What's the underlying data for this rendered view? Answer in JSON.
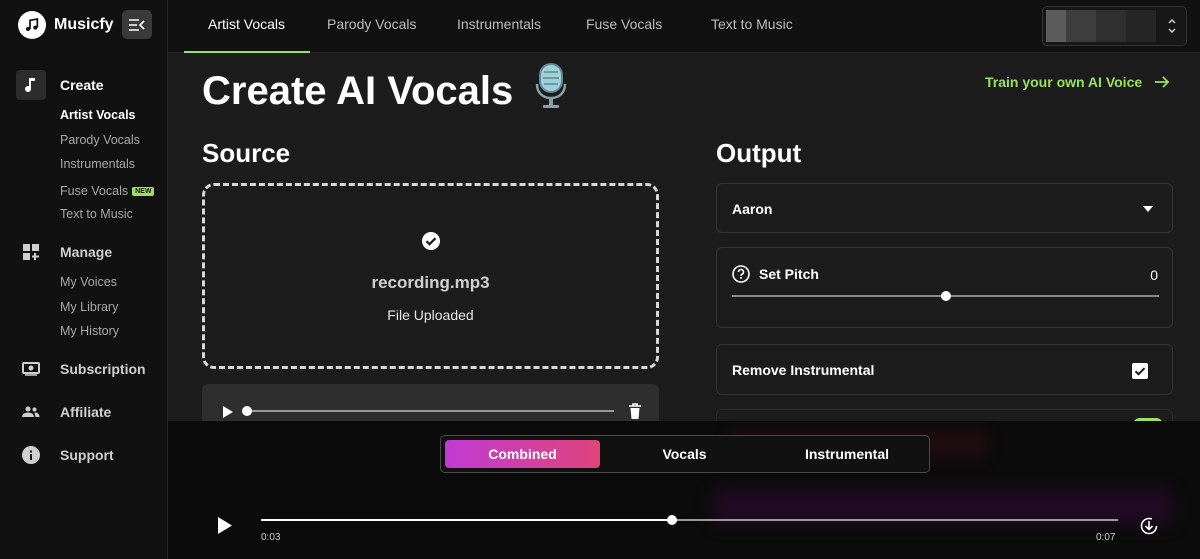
{
  "app": {
    "name": "Musicfy"
  },
  "sidebar": {
    "sections": [
      {
        "label": "Create",
        "icon": "music-note-icon"
      },
      {
        "label": "Manage",
        "icon": "grid-plus-icon"
      },
      {
        "label": "Subscription",
        "icon": "subscription-icon"
      },
      {
        "label": "Affiliate",
        "icon": "people-icon"
      },
      {
        "label": "Support",
        "icon": "info-icon"
      }
    ],
    "create_items": [
      "Artist Vocals",
      "Parody Vocals",
      "Instrumentals",
      "Fuse Vocals",
      "Text to Music"
    ],
    "new_badge": "NEW",
    "manage_items": [
      "My Voices",
      "My Library",
      "My History"
    ]
  },
  "tabs": [
    "Artist Vocals",
    "Parody Vocals",
    "Instrumentals",
    "Fuse Vocals",
    "Text to Music"
  ],
  "main": {
    "title": "Create AI Vocals",
    "train_link": "Train your own AI Voice",
    "source_heading": "Source",
    "output_heading": "Output",
    "file_name": "recording.mp3",
    "file_status": "File Uploaded",
    "voice_selected": "Aaron",
    "pitch_label": "Set Pitch",
    "pitch_value": "0",
    "pitch_fraction": 0.5,
    "remove_instrumental_label": "Remove Instrumental",
    "remove_instrumental_checked": true
  },
  "player": {
    "modes": [
      "Combined",
      "Vocals",
      "Instrumental"
    ],
    "active_mode": "Combined",
    "current_time": "0:03",
    "total_time": "0:07",
    "progress_fraction": 0.48
  },
  "colors": {
    "accent": "#9be15d",
    "gradient_start": "#c03bd4",
    "gradient_end": "#e0447a"
  }
}
